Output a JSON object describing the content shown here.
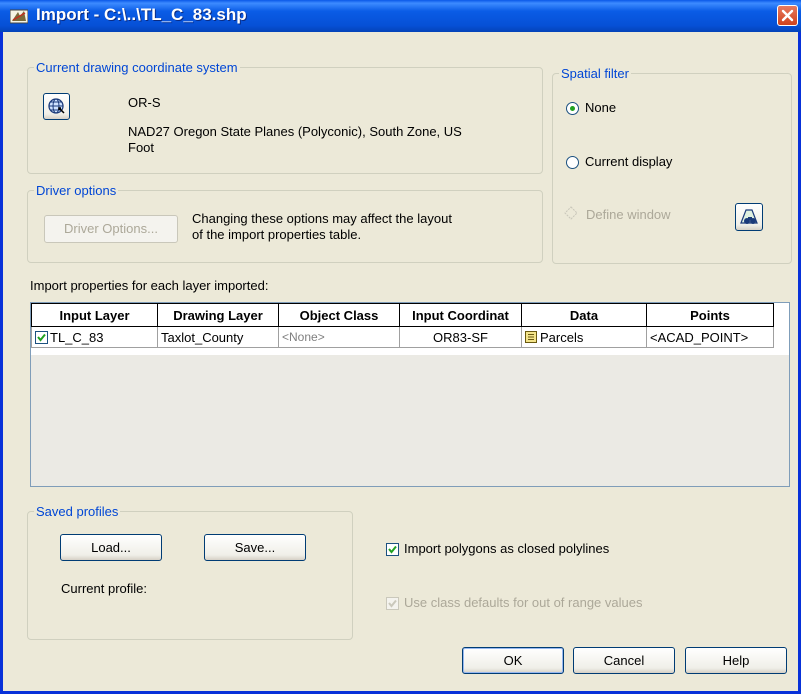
{
  "window": {
    "title": "Import - C:\\..\\TL_C_83.shp"
  },
  "coord": {
    "legend": "Current drawing coordinate system",
    "code": "OR-S",
    "desc_line1": "NAD27 Oregon State Planes (Polyconic), South Zone, US",
    "desc_line2": "Foot"
  },
  "driver": {
    "legend": "Driver options",
    "button": "Driver Options...",
    "note_line1": "Changing these options may affect the layout",
    "note_line2": "of the import properties table."
  },
  "spatial": {
    "legend": "Spatial filter",
    "none": "None",
    "current_display": "Current display",
    "define_window": "Define window",
    "selected": "None"
  },
  "props": {
    "label": "Import properties for each layer imported:",
    "columns": [
      "Input Layer",
      "Drawing Layer",
      "Object Class",
      "Input Coordinat",
      "Data",
      "Points"
    ],
    "rows": [
      {
        "input_layer": "TL_C_83",
        "checked": true,
        "drawing_layer": "Taxlot_County",
        "object_class": "<None>",
        "input_coord": "OR83-SF",
        "data": "Parcels",
        "points": "<ACAD_POINT>"
      }
    ]
  },
  "profiles": {
    "legend": "Saved profiles",
    "load": "Load...",
    "save": "Save...",
    "current_label": "Current profile:"
  },
  "options": {
    "polygons": {
      "label": "Import polygons as closed polylines",
      "checked": true
    },
    "class_defaults": {
      "label": "Use class defaults for out of range values",
      "checked": true,
      "disabled": true
    }
  },
  "buttons": {
    "ok": "OK",
    "cancel": "Cancel",
    "help": "Help"
  }
}
